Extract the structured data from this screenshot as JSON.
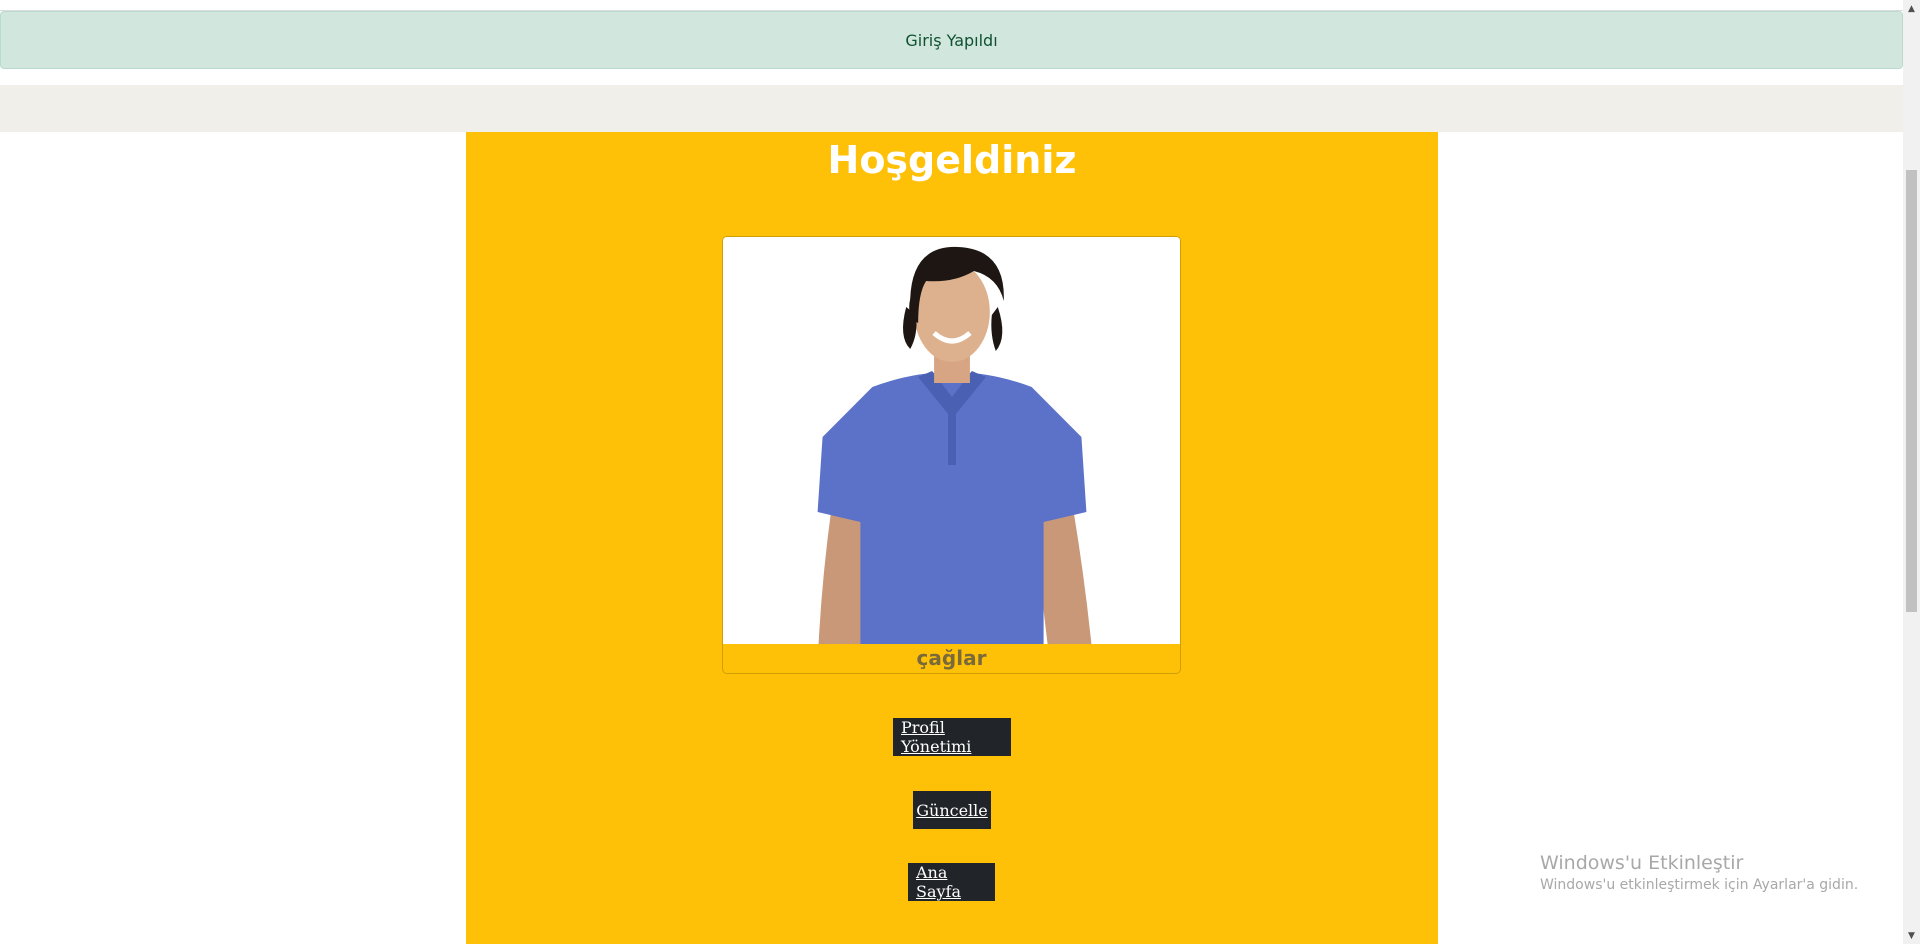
{
  "alert": {
    "text": "Giriş Yapıldı",
    "color": "#d1e7dd"
  },
  "panel": {
    "title": "Hoşgeldiniz",
    "background": "#fec107"
  },
  "profile": {
    "name": "çağlar",
    "photo_icon": "profile-photo"
  },
  "buttons": {
    "profile_management": "Profil Yönetimi",
    "update": "Güncelle",
    "home": "Ana Sayfa"
  },
  "watermark": {
    "title": "Windows'u Etkinleştir",
    "subtitle": "Windows'u etkinleştirmek için Ayarlar'a gidin."
  },
  "scrollbar": {
    "up_icon": "chevron-up-icon",
    "down_icon": "chevron-down-icon"
  }
}
